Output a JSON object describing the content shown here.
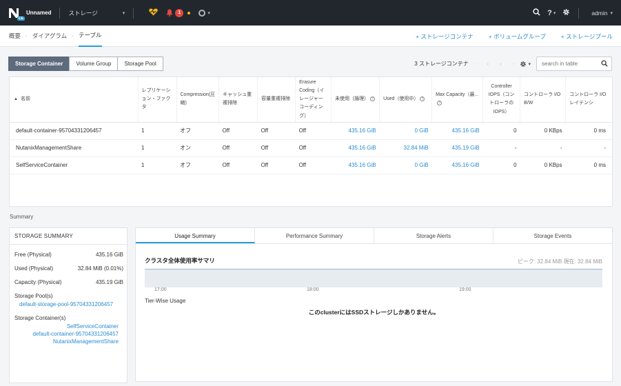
{
  "topbar": {
    "cluster_name": "Unnamed",
    "logo_badge": "CE",
    "menu_label": "ストレージ",
    "alert_count": "1",
    "user": "admin"
  },
  "breadcrumb": {
    "items": [
      "概要",
      "ダイアグラム",
      "テーブル"
    ]
  },
  "actions": {
    "storage_container": "+ ストレージコンテナ",
    "volume_group": "+ ボリュームグループ",
    "storage_pool": "+ ストレージプール"
  },
  "segments": [
    "Storage Container",
    "Volume Group",
    "Storage Pool"
  ],
  "table_tools": {
    "count_label": "3 ストレージコンテナ",
    "search_placeholder": "search in table"
  },
  "table": {
    "headers": [
      "名前",
      "レプリケーション・ファクタ",
      "Compression(圧縮)",
      "キャッシュ重複排除",
      "容量重複排除",
      "Erasure Coding（イレージャーコーディング）",
      "未使用（論理）",
      "Used（使用中）",
      "Max Capacity（最...",
      "Controller IOPS（コントローラの IOPS）",
      "コントローラ I/O B/W",
      "コントローラ I/O レイテンシ"
    ],
    "rows": [
      [
        "default-container-95704331206457",
        "1",
        "オフ",
        "Off",
        "Off",
        "Off",
        "435.16 GiB",
        "0 GiB",
        "435.16 GiB",
        "0",
        "0 KBps",
        "0 ms"
      ],
      [
        "NutanixManagementShare",
        "1",
        "オン",
        "Off",
        "Off",
        "Off",
        "435.16 GiB",
        "32.84 MiB",
        "435.19 GiB",
        "-",
        "-",
        "-"
      ],
      [
        "SelfServiceContainer",
        "1",
        "オフ",
        "Off",
        "Off",
        "Off",
        "435.16 GiB",
        "0 GiB",
        "435.16 GiB",
        "0",
        "0 KBps",
        "0 ms"
      ]
    ]
  },
  "summary": {
    "label": "Summary",
    "panel_title": "STORAGE SUMMARY",
    "free_label": "Free (Physical)",
    "free_value": "435.16 GiB",
    "used_label": "Used (Physical)",
    "used_value": "32.84 MiB (0.01%)",
    "capacity_label": "Capacity (Physical)",
    "capacity_value": "435.19 GiB",
    "pools_label": "Storage Pool(s)",
    "pool": "default-storage-pool-95704331206457",
    "containers_label": "Storage Container(s)",
    "containers": [
      "SelfServiceContainer",
      "default-container-95704331206457",
      "NutanixManagementShare"
    ]
  },
  "main_panel": {
    "tabs": [
      "Usage Summary",
      "Performance Summary",
      "Storage Alerts",
      "Storage Events"
    ],
    "chart_title": "クラスタ全体使用率サマリ",
    "peak_text": "ピーク: 32.84 MiB  現在: 32.84 MiB",
    "ticks": [
      "17:00",
      "18:00",
      "19:00"
    ],
    "tier_title": "Tier-Wise Usage",
    "tier_message": "このclusterにはSSDストレージしかありません。"
  },
  "colors": {
    "topbar_bg": "#22272e",
    "accent": "#2a9cd8",
    "link": "#2a8bd1",
    "alert": "#e2483d"
  }
}
